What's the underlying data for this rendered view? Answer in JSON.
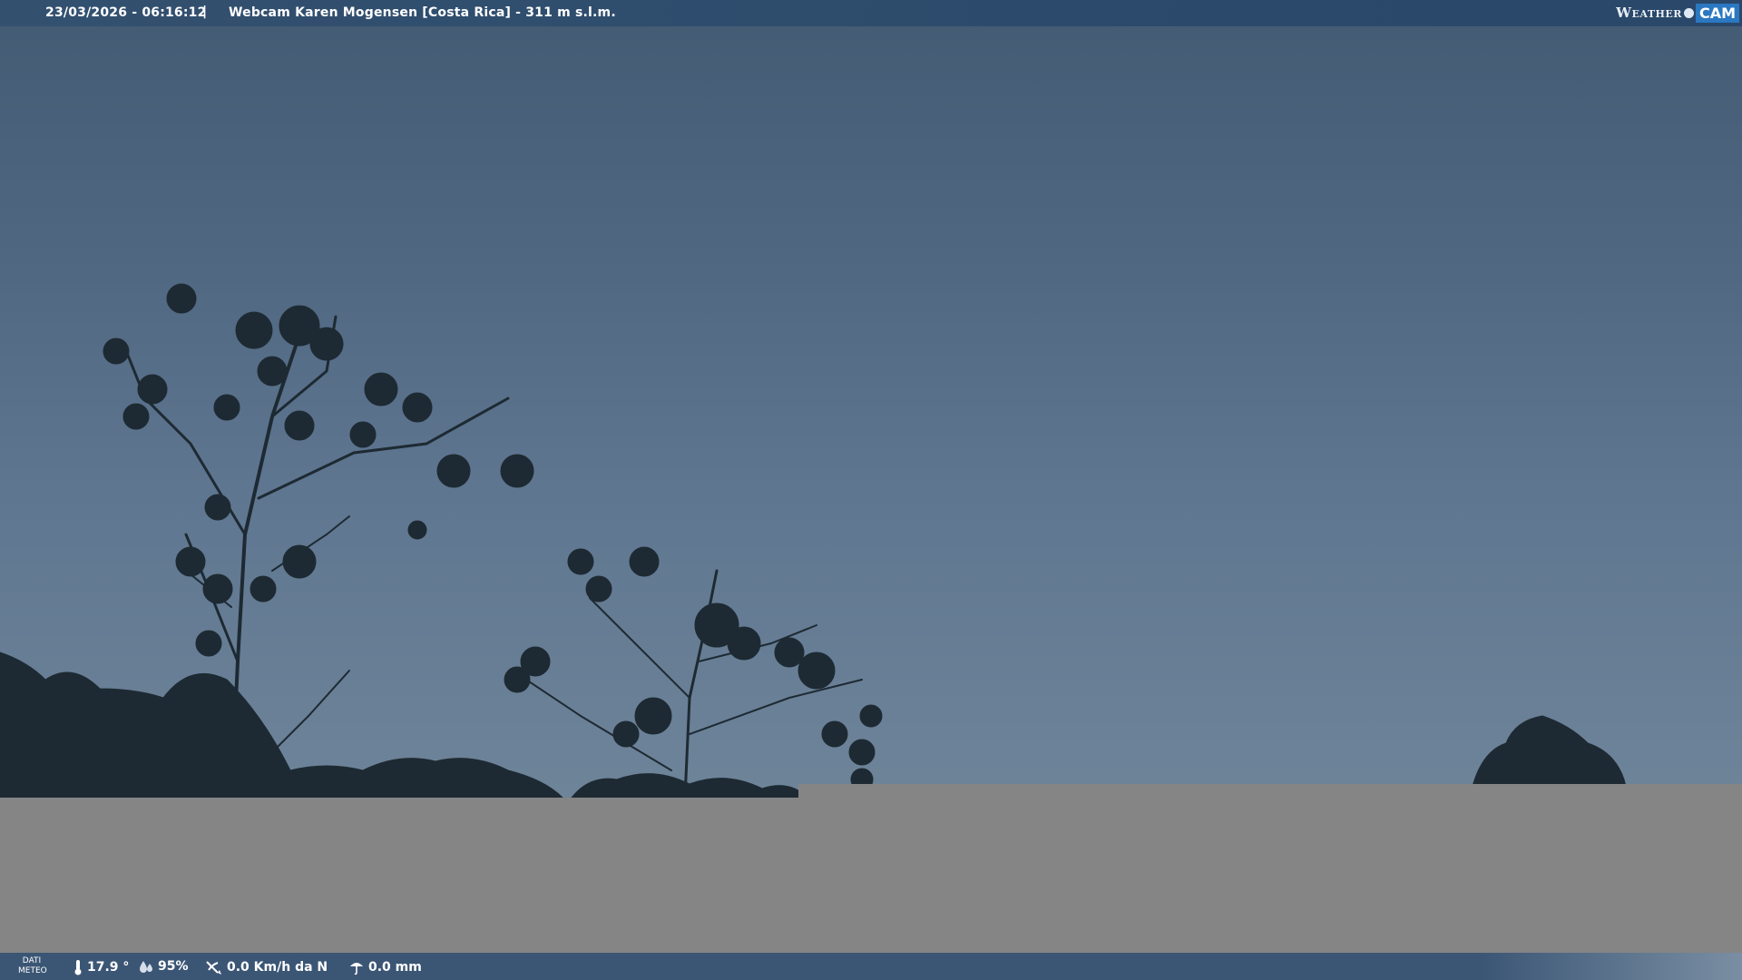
{
  "header": {
    "timestamp": "23/03/2026 - 06:16:12",
    "separator": "|",
    "title": "Webcam Karen Mogensen [Costa Rica]  - 311 m s.l.m."
  },
  "logo": {
    "weather": "Weather",
    "cam": "CAM"
  },
  "weather_bar": {
    "label_line1": "DATI",
    "label_line2": "METEO",
    "temperature": "17.9 °",
    "humidity": "95%",
    "wind": "0.0 Km/h da N",
    "rain": "0.0 mm",
    "icons": [
      "thermometer-icon",
      "humidity-icon",
      "wind-icon",
      "rain-icon"
    ]
  },
  "colors": {
    "header_bg": "#2b4a6b",
    "footer_bg": "#3b5675",
    "sky_top": "#445c74",
    "sky_bottom": "#6e8499",
    "gray_fill": "#858585",
    "logo_accent": "#2b78c2"
  }
}
